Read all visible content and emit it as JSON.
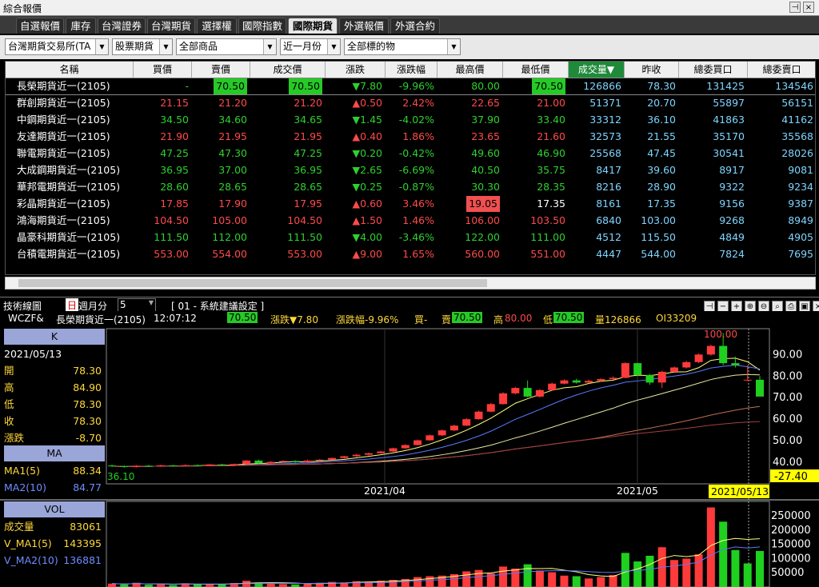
{
  "window_title": "綜合報價",
  "window_buttons": [
    "⊣",
    "×"
  ],
  "tabs": [
    "自選報價",
    "庫存",
    "台灣證券",
    "台灣期貨",
    "選擇權",
    "國際指數",
    "國際期貨",
    "外選報價",
    "外選合約"
  ],
  "filters": [
    "台灣期貨交易所(TA",
    "股票期貨",
    "全部商品",
    "近一月份",
    "全部標的物"
  ],
  "columns": [
    "名稱",
    "買價",
    "賣價",
    "成交價",
    "漲跌",
    "漲跌幅",
    "最高價",
    "最低價",
    "成交量▼",
    "昨收",
    "總委買口",
    "總委賣口"
  ],
  "rows": [
    {
      "name": "長榮期貨近一(2105)",
      "bid": "-",
      "ask": "70.50",
      "last": "70.50",
      "chg": "▼7.80",
      "pct": "-9.96%",
      "high": "80.00",
      "low": "70.50",
      "vol": "126866",
      "prev": "78.30",
      "buy": "131425",
      "sell": "134546",
      "dir": "dn"
    },
    {
      "name": "群創期貨近一(2105)",
      "bid": "21.15",
      "ask": "21.20",
      "last": "21.20",
      "chg": "▲0.50",
      "pct": "2.42%",
      "high": "22.65",
      "low": "21.00",
      "vol": "51371",
      "prev": "20.70",
      "buy": "55897",
      "sell": "56151",
      "dir": "up"
    },
    {
      "name": "中鋼期貨近一(2105)",
      "bid": "34.50",
      "ask": "34.60",
      "last": "34.65",
      "chg": "▼1.45",
      "pct": "-4.02%",
      "high": "37.90",
      "low": "33.40",
      "vol": "33312",
      "prev": "36.10",
      "buy": "41863",
      "sell": "41162",
      "dir": "dn"
    },
    {
      "name": "友達期貨近一(2105)",
      "bid": "21.90",
      "ask": "21.95",
      "last": "21.95",
      "chg": "▲0.40",
      "pct": "1.86%",
      "high": "23.65",
      "low": "21.60",
      "vol": "32573",
      "prev": "21.55",
      "buy": "35170",
      "sell": "35568",
      "dir": "up"
    },
    {
      "name": "聯電期貨近一(2105)",
      "bid": "47.25",
      "ask": "47.30",
      "last": "47.25",
      "chg": "▼0.20",
      "pct": "-0.42%",
      "high": "49.60",
      "low": "46.90",
      "vol": "25568",
      "prev": "47.45",
      "buy": "30541",
      "sell": "28026",
      "dir": "dn"
    },
    {
      "name": "大成鋼期貨近一(2105)",
      "bid": "36.95",
      "ask": "37.00",
      "last": "36.95",
      "chg": "▼2.65",
      "pct": "-6.69%",
      "high": "40.50",
      "low": "35.75",
      "vol": "8417",
      "prev": "39.60",
      "buy": "8917",
      "sell": "9081",
      "dir": "dn"
    },
    {
      "name": "華邦電期貨近一(2105)",
      "bid": "28.60",
      "ask": "28.65",
      "last": "28.65",
      "chg": "▼0.25",
      "pct": "-0.87%",
      "high": "30.30",
      "low": "28.35",
      "vol": "8216",
      "prev": "28.90",
      "buy": "9322",
      "sell": "9234",
      "dir": "dn"
    },
    {
      "name": "彩晶期貨近一(2105)",
      "bid": "17.85",
      "ask": "17.90",
      "last": "17.95",
      "chg": "▲0.60",
      "pct": "3.46%",
      "high": "19.05",
      "low": "17.35",
      "vol": "8161",
      "prev": "17.35",
      "buy": "9156",
      "sell": "9387",
      "dir": "up"
    },
    {
      "name": "鴻海期貨近一(2105)",
      "bid": "104.50",
      "ask": "105.00",
      "last": "104.50",
      "chg": "▲1.50",
      "pct": "1.46%",
      "high": "106.00",
      "low": "103.50",
      "vol": "6840",
      "prev": "103.00",
      "buy": "9268",
      "sell": "8949",
      "dir": "up"
    },
    {
      "name": "晶豪科期貨近一(2105)",
      "bid": "111.50",
      "ask": "112.00",
      "last": "111.50",
      "chg": "▼4.00",
      "pct": "-3.46%",
      "high": "122.00",
      "low": "111.00",
      "vol": "4512",
      "prev": "115.50",
      "buy": "4849",
      "sell": "4905",
      "dir": "dn"
    },
    {
      "name": "台積電期貨近一(2105)",
      "bid": "553.00",
      "ask": "554.00",
      "last": "553.00",
      "chg": "▲9.00",
      "pct": "1.65%",
      "high": "560.00",
      "low": "551.00",
      "vol": "4447",
      "prev": "544.00",
      "buy": "7824",
      "sell": "7695",
      "dir": "up"
    }
  ],
  "chart": {
    "panel_title": "技術線圖",
    "period_day": "日",
    "period_label": "週月分",
    "period_value": "5",
    "preset": "[ 01 - 系統建議設定 ]",
    "quote": {
      "code": "WCZF&",
      "name": "長榮期貨近一(2105)",
      "time": "12:07:12",
      "price": "70.50",
      "chg_label": "漲跌▼7.80",
      "pct_label": "漲跌幅-9.96%",
      "bid_label": "買-",
      "ask_label": "賣",
      "ask": "70.50",
      "high_label": "高",
      "high": "80.00",
      "low_label": "低",
      "low": "70.50",
      "vol_label": "量126866",
      "oi_label": "OI33209"
    },
    "k_panel": {
      "title": "K",
      "date": "2021/05/13",
      "items": [
        {
          "l": "開",
          "v": "78.30"
        },
        {
          "l": "高",
          "v": "84.90"
        },
        {
          "l": "低",
          "v": "78.30"
        },
        {
          "l": "收",
          "v": "78.30"
        },
        {
          "l": "漲跌",
          "v": "-8.70"
        }
      ]
    },
    "ma_panel": {
      "title": "MA",
      "items": [
        {
          "l": "MA1(5)",
          "v": "88.34"
        },
        {
          "l": "MA2(10)",
          "v": "84.77"
        }
      ]
    },
    "vol_panel": {
      "title": "VOL",
      "items": [
        {
          "l": "成交量",
          "v": "83061"
        },
        {
          "l": "V_MA1(5)",
          "v": "143395"
        },
        {
          "l": "V_MA2(10)",
          "v": "136881"
        }
      ]
    },
    "price_axis": [
      "90.00",
      "80.00",
      "70.00",
      "60.00",
      "50.00",
      "40.00"
    ],
    "cursor_value": "-27.40",
    "min_label": "36.10",
    "max_label": "100.00",
    "date_labels": [
      "2021/04",
      "2021/05"
    ],
    "cursor_date": "2021/05/13",
    "vol_axis": [
      "250000",
      "200000",
      "150000",
      "100000",
      "50000"
    ]
  },
  "candles": [
    [
      38.5,
      38.2,
      38.9,
      37.9
    ],
    [
      38.2,
      37.8,
      38.6,
      37.5
    ],
    [
      37.8,
      38.4,
      38.7,
      37.6
    ],
    [
      38.4,
      38.1,
      38.8,
      37.9
    ],
    [
      38.1,
      38.6,
      38.9,
      37.9
    ],
    [
      38.6,
      38.3,
      38.8,
      38.0
    ],
    [
      38.3,
      38.7,
      39.0,
      38.1
    ],
    [
      38.7,
      38.4,
      39.0,
      38.2
    ],
    [
      38.4,
      39.0,
      39.2,
      38.3
    ],
    [
      39.0,
      38.6,
      39.3,
      38.4
    ],
    [
      38.6,
      39.2,
      39.4,
      38.5
    ],
    [
      39.2,
      40.8,
      41.0,
      39.0
    ],
    [
      40.8,
      39.5,
      41.2,
      39.2
    ],
    [
      39.5,
      40.2,
      40.5,
      39.3
    ],
    [
      40.2,
      40.6,
      40.9,
      40.0
    ],
    [
      40.6,
      40.1,
      40.9,
      39.8
    ],
    [
      40.1,
      40.8,
      41.2,
      39.9
    ],
    [
      40.8,
      41.2,
      41.5,
      40.5
    ],
    [
      41.2,
      42.0,
      42.2,
      41.0
    ],
    [
      42.0,
      42.8,
      43.0,
      41.8
    ],
    [
      42.8,
      43.5,
      43.9,
      42.5
    ],
    [
      43.5,
      44.2,
      44.5,
      43.2
    ],
    [
      44.2,
      45.0,
      45.3,
      44.0
    ],
    [
      45.0,
      46.5,
      46.8,
      44.8
    ],
    [
      46.5,
      48.0,
      48.4,
      46.2
    ],
    [
      48.0,
      50.2,
      50.6,
      47.8
    ],
    [
      50.2,
      52.5,
      52.9,
      50.0
    ],
    [
      52.5,
      54.8,
      55.2,
      52.2
    ],
    [
      54.8,
      57.0,
      57.5,
      54.5
    ],
    [
      57.0,
      60.0,
      60.5,
      56.8
    ],
    [
      60.0,
      63.5,
      64.0,
      59.8
    ],
    [
      63.5,
      67.0,
      67.5,
      63.2
    ],
    [
      67.0,
      72.0,
      72.5,
      66.8
    ],
    [
      72.0,
      74.5,
      75.0,
      71.5
    ],
    [
      74.5,
      70.5,
      78.0,
      70.2
    ],
    [
      70.5,
      73.5,
      74.0,
      70.0
    ],
    [
      73.5,
      76.5,
      77.0,
      73.2
    ],
    [
      76.5,
      78.0,
      78.5,
      76.2
    ],
    [
      78.0,
      77.0,
      78.8,
      76.5
    ],
    [
      77.0,
      77.8,
      78.4,
      76.6
    ],
    [
      77.8,
      78.6,
      79.0,
      77.4
    ],
    [
      78.6,
      79.2,
      79.8,
      78.2
    ],
    [
      79.2,
      86.0,
      86.5,
      79.0
    ],
    [
      86.0,
      80.5,
      86.2,
      80.0
    ],
    [
      80.5,
      77.0,
      81.0,
      76.0
    ],
    [
      77.0,
      82.0,
      82.5,
      74.5
    ],
    [
      82.0,
      84.0,
      84.5,
      81.5
    ],
    [
      84.0,
      86.5,
      87.0,
      83.5
    ],
    [
      86.5,
      90.0,
      90.5,
      86.0
    ],
    [
      90.0,
      94.0,
      94.5,
      89.5
    ],
    [
      94.0,
      86.0,
      100.0,
      85.0
    ],
    [
      86.0,
      85.0,
      89.0,
      84.0
    ],
    [
      78.3,
      78.3,
      84.9,
      78.3
    ],
    [
      78.3,
      70.5,
      80.0,
      70.5
    ]
  ],
  "volumes": [
    [
      12000,
      "up"
    ],
    [
      9000,
      "dn"
    ],
    [
      15000,
      "up"
    ],
    [
      8000,
      "dn"
    ],
    [
      11000,
      "up"
    ],
    [
      7000,
      "dn"
    ],
    [
      13000,
      "up"
    ],
    [
      10000,
      "dn"
    ],
    [
      9000,
      "up"
    ],
    [
      11000,
      "dn"
    ],
    [
      14000,
      "up"
    ],
    [
      22000,
      "up"
    ],
    [
      16000,
      "dn"
    ],
    [
      12000,
      "up"
    ],
    [
      10000,
      "up"
    ],
    [
      9000,
      "dn"
    ],
    [
      13000,
      "up"
    ],
    [
      15000,
      "up"
    ],
    [
      18000,
      "up"
    ],
    [
      16000,
      "up"
    ],
    [
      20000,
      "up"
    ],
    [
      19000,
      "up"
    ],
    [
      22000,
      "up"
    ],
    [
      25000,
      "up"
    ],
    [
      28000,
      "up"
    ],
    [
      35000,
      "up"
    ],
    [
      38000,
      "up"
    ],
    [
      40000,
      "up"
    ],
    [
      45000,
      "up"
    ],
    [
      55000,
      "up"
    ],
    [
      60000,
      "up"
    ],
    [
      48000,
      "up"
    ],
    [
      72000,
      "up"
    ],
    [
      65000,
      "up"
    ],
    [
      80000,
      "dn"
    ],
    [
      58000,
      "up"
    ],
    [
      52000,
      "up"
    ],
    [
      40000,
      "up"
    ],
    [
      38000,
      "dn"
    ],
    [
      30000,
      "up"
    ],
    [
      35000,
      "up"
    ],
    [
      42000,
      "up"
    ],
    [
      120000,
      "dn"
    ],
    [
      90000,
      "dn"
    ],
    [
      110000,
      "dn"
    ],
    [
      140000,
      "up"
    ],
    [
      95000,
      "up"
    ],
    [
      100000,
      "up"
    ],
    [
      115000,
      "up"
    ],
    [
      280000,
      "up"
    ],
    [
      230000,
      "dn"
    ],
    [
      130000,
      "dn"
    ],
    [
      83061,
      "dn"
    ],
    [
      126866,
      "dn"
    ]
  ]
}
